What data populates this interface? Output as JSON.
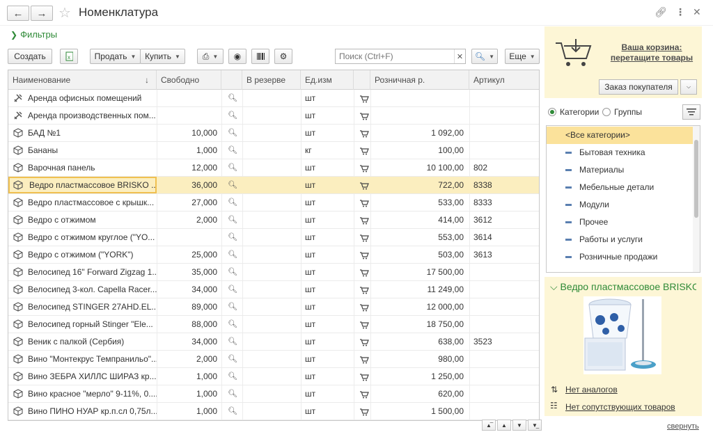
{
  "window": {
    "title": "Номенклатура",
    "back_icon": "arrow-left-icon",
    "forward_icon": "arrow-right-icon"
  },
  "filters": {
    "label": "Фильтры"
  },
  "toolbar": {
    "create_label": "Создать",
    "sell_label": "Продать",
    "buy_label": "Купить",
    "search_placeholder": "Поиск (Ctrl+F)",
    "more_label": "Еще"
  },
  "table": {
    "columns": [
      "Наименование",
      "Свободно",
      "",
      "В резерве",
      "Ед.изм",
      "",
      "Розничная р.",
      "Артикул"
    ],
    "rows": [
      {
        "name": "Аренда офисных помещений",
        "free": "",
        "unit": "шт",
        "price": "",
        "sku": "",
        "icon": "tools-icon"
      },
      {
        "name": "Аренда производственных пом...",
        "free": "",
        "unit": "шт",
        "price": "",
        "sku": "",
        "icon": "tools-icon"
      },
      {
        "name": "БАД №1",
        "free": "10,000",
        "unit": "шт",
        "price": "1 092,00",
        "sku": "",
        "icon": "box-icon"
      },
      {
        "name": "Бананы",
        "free": "1,000",
        "unit": "кг",
        "price": "100,00",
        "sku": "",
        "icon": "box-icon"
      },
      {
        "name": "Варочная панель",
        "free": "12,000",
        "unit": "шт",
        "price": "10 100,00",
        "sku": "802",
        "icon": "box-icon"
      },
      {
        "name": "Ведро пластмассовое BRISKO ...",
        "free": "36,000",
        "unit": "шт",
        "price": "722,00",
        "sku": "8338",
        "icon": "box-icon",
        "selected": true
      },
      {
        "name": "Ведро пластмассовое с крышк...",
        "free": "27,000",
        "unit": "шт",
        "price": "533,00",
        "sku": "8333",
        "icon": "box-icon"
      },
      {
        "name": "Ведро с отжимом",
        "free": "2,000",
        "unit": "шт",
        "price": "414,00",
        "sku": "3612",
        "icon": "box-icon"
      },
      {
        "name": "Ведро с отжимом  круглое (\"YO...",
        "free": "",
        "unit": "шт",
        "price": "553,00",
        "sku": "3614",
        "icon": "box-icon"
      },
      {
        "name": "Ведро с отжимом (\"YORK\")",
        "free": "25,000",
        "unit": "шт",
        "price": "503,00",
        "sku": "3613",
        "icon": "box-icon"
      },
      {
        "name": "Велосипед 16\" Forward Zigzag 1...",
        "free": "35,000",
        "unit": "шт",
        "price": "17 500,00",
        "sku": "",
        "icon": "box-icon"
      },
      {
        "name": "Велосипед 3-кол. Capella Racer...",
        "free": "34,000",
        "unit": "шт",
        "price": "11 249,00",
        "sku": "",
        "icon": "box-icon"
      },
      {
        "name": "Велосипед STINGER 27AHD.EL...",
        "free": "89,000",
        "unit": "шт",
        "price": "12 000,00",
        "sku": "",
        "icon": "box-icon"
      },
      {
        "name": "Велосипед горный Stinger \"Ele...",
        "free": "88,000",
        "unit": "шт",
        "price": "18 750,00",
        "sku": "",
        "icon": "box-icon"
      },
      {
        "name": "Веник с палкой (Сербия)",
        "free": "34,000",
        "unit": "шт",
        "price": "638,00",
        "sku": "3523",
        "icon": "box-icon"
      },
      {
        "name": "Вино \"Монтекрус Темпранильо\"...",
        "free": "2,000",
        "unit": "шт",
        "price": "980,00",
        "sku": "",
        "icon": "box-icon"
      },
      {
        "name": "Вино ЗЕБРА ХИЛЛС ШИРАЗ кр...",
        "free": "1,000",
        "unit": "шт",
        "price": "1 250,00",
        "sku": "",
        "icon": "box-icon"
      },
      {
        "name": "Вино красное \"мерло\" 9-11%, 0....",
        "free": "1,000",
        "unit": "шт",
        "price": "620,00",
        "sku": "",
        "icon": "box-icon"
      },
      {
        "name": "Вино ПИНО НУАР кр.п.сл 0,75л...",
        "free": "1,000",
        "unit": "шт",
        "price": "1 500,00",
        "sku": "",
        "icon": "box-icon"
      }
    ]
  },
  "basket": {
    "link_line1": "Ваша корзина:",
    "link_line2": "перетащите товары",
    "order_label": "Заказ покупателя"
  },
  "categories": {
    "radio_categories": "Категории",
    "radio_groups": "Группы",
    "items": [
      "<Все категории>",
      "Бытовая техника",
      "Материалы",
      "Мебельные детали",
      "Модули",
      "Прочее",
      "Работы и услуги",
      "Розничные продажи"
    ]
  },
  "detail": {
    "title": "Ведро пластмассовое BRISKO",
    "analogs_link": "Нет аналогов",
    "related_link": "Нет сопутствующих товаров",
    "collapse_link": "свернуть"
  },
  "colors": {
    "accent": "#2e8a37",
    "selection": "#fbeebf",
    "panel": "#fdf6d6"
  }
}
